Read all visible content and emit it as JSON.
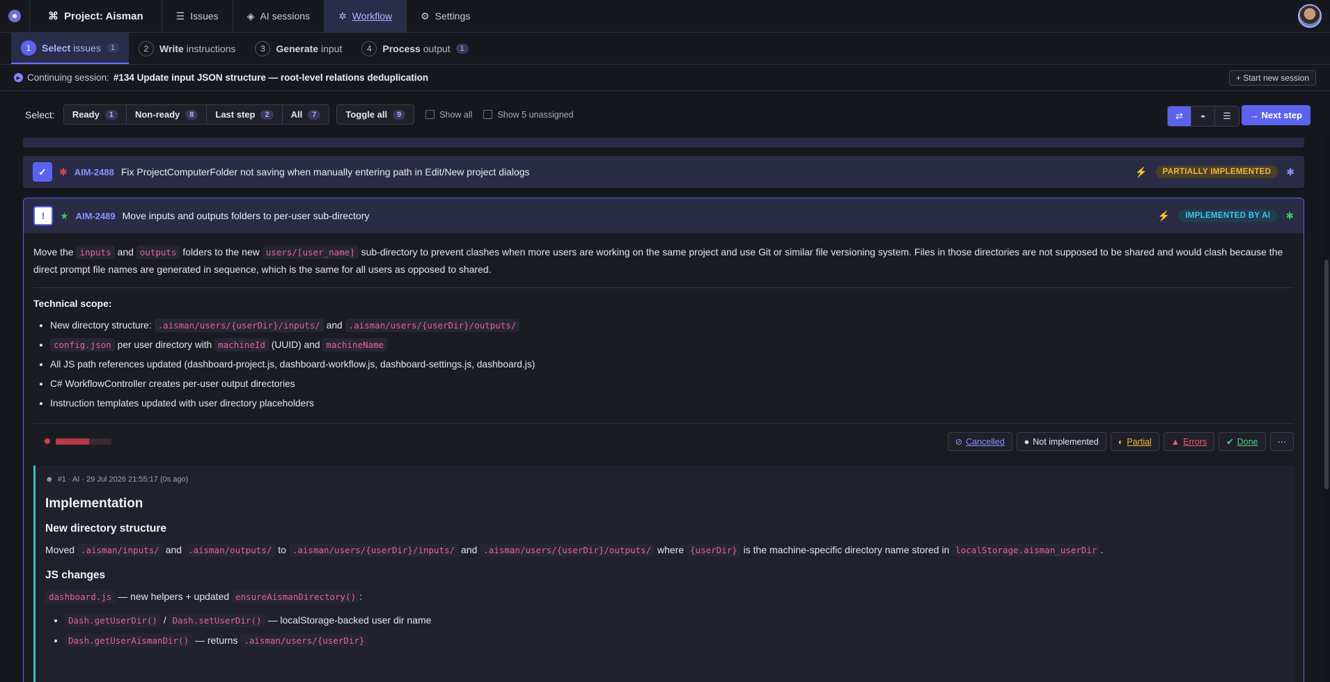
{
  "nav": {
    "project": "Project: Aisman",
    "issues": "Issues",
    "ai_sessions": "AI sessions",
    "workflow": "Workflow",
    "settings": "Settings"
  },
  "steps": [
    {
      "num": "1",
      "bold": "Select",
      "rest": "issues",
      "count": "1"
    },
    {
      "num": "2",
      "bold": "Write",
      "rest": "instructions"
    },
    {
      "num": "3",
      "bold": "Generate",
      "rest": "input"
    },
    {
      "num": "4",
      "bold": "Process",
      "rest": "output",
      "count": "1"
    }
  ],
  "session": {
    "prefix": "Continuing session:",
    "title": "#134 Update input JSON structure — root-level relations deduplication",
    "start_new": "+ Start new session"
  },
  "toolbar": {
    "select_label": "Select:",
    "ready": "Ready",
    "ready_count": "1",
    "nonready": "Non-ready",
    "nonready_count": "8",
    "laststep": "Last step",
    "laststep_count": "2",
    "all": "All",
    "all_count": "7",
    "toggle_all": "Toggle all",
    "toggle_count": "9",
    "show_all": "Show all",
    "show_unassigned": "Show 5 unassigned",
    "next_step": "→ Next step"
  },
  "issues": [
    {
      "id": "AIM-2488",
      "title": "Fix ProjectComputerFolder not saving when manually entering path in Edit/New project dialogs",
      "status": "PARTIALLY IMPLEMENTED",
      "type_icon": "bug-icon"
    },
    {
      "id": "AIM-2489",
      "title": "Move inputs and outputs folders to per-user sub-directory",
      "status": "IMPLEMENTED BY AI",
      "type_icon": "star-icon",
      "description": {
        "t1": "Move the",
        "c1": "inputs",
        "t2": "and",
        "c2": "outputs",
        "t3": "folders to the new",
        "c3": "users/[user_name]",
        "t4": "sub-directory to prevent clashes when more users are working on the same project and use Git or similar file versioning system. Files in those directories are not supposed to be shared and would clash because the direct prompt file names are generated in sequence, which is the same for all users as opposed to shared."
      },
      "scope_title": "Technical scope:",
      "scope": {
        "l1_text": "New directory structure:",
        "l1_code1": ".aisman/users/{userDir}/inputs/",
        "l1_and": "and",
        "l1_code2": ".aisman/users/{userDir}/outputs/",
        "l2_code1": "config.json",
        "l2_text": "per user directory with",
        "l2_code2": "machineId",
        "l2_text2": "(UUID) and",
        "l2_code3": "machineName",
        "l3": "All JS path references updated (dashboard-project.js, dashboard-workflow.js, dashboard-settings.js, dashboard.js)",
        "l4": "C# WorkflowController creates per-user output directories",
        "l5": "Instruction templates updated with user directory placeholders"
      },
      "bug_meter": 0.6,
      "actions": {
        "cancelled": "Cancelled",
        "not_implemented": "Not implemented",
        "partial": "Partial",
        "errors": "Errors",
        "done": "Done",
        "more": "···"
      },
      "note": {
        "meta": "#1 · AI · 29 Jul 2026 21:55:17 (0s ago)",
        "h_impl": "Implementation",
        "h_dir": "New directory structure",
        "p_moved": "Moved",
        "c_in": ".aisman/inputs/",
        "p_and": "and",
        "c_out": ".aisman/outputs/",
        "p_to": "to",
        "c_uin": ".aisman/users/{userDir}/inputs/",
        "p_and2": "and",
        "c_uout": ".aisman/users/{userDir}/outputs/",
        "p_where": "where",
        "c_ud": "{userDir}",
        "p_is": "is the machine-specific directory name stored in",
        "c_ls": "localStorage.aisman_userDir",
        "p_dot": ".",
        "h_js": "JS changes",
        "c_dash": "dashboard.js",
        "p_helpers": "— new helpers + updated",
        "c_ensure": "ensureAismanDirectory()",
        "p_colon": ":",
        "b1_c1": "Dash.getUserDir()",
        "b1_slash": "/",
        "b1_c2": "Dash.setUserDir()",
        "b1_t": "— localStorage-backed user dir name",
        "b2_c1": "Dash.getUserAismanDir()",
        "b2_t": "— returns",
        "b2_c2": ".aisman/users/{userDir}"
      }
    }
  ]
}
